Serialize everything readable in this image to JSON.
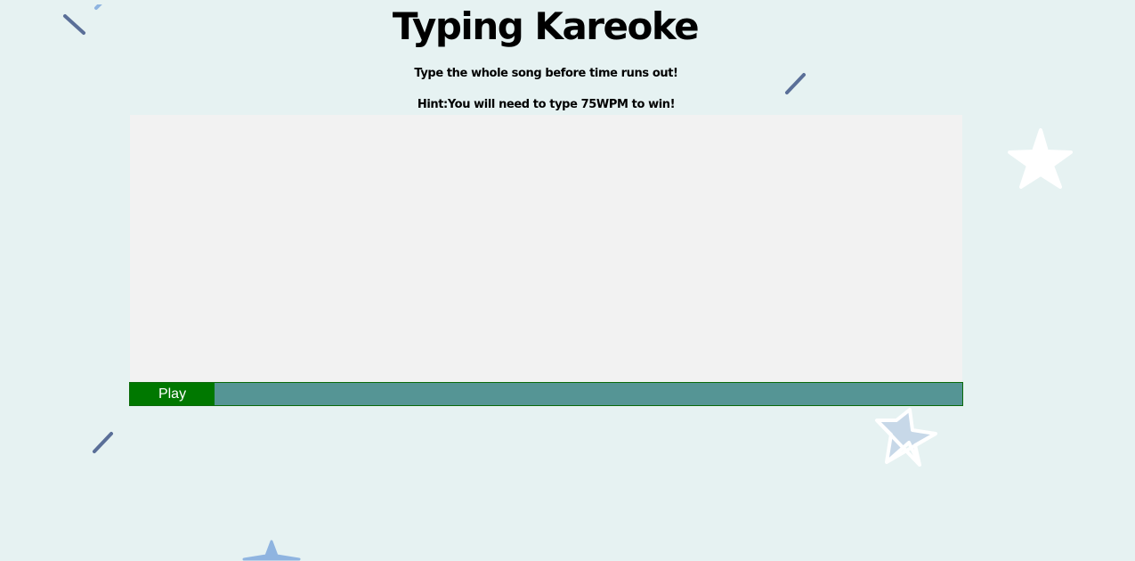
{
  "header": {
    "title": "Typing Kareoke",
    "instruction": "Type the whole song before time runs out!",
    "hint": "Hint:You will need to type 75WPM to win!"
  },
  "player": {
    "play_label": "Play",
    "progress": 0
  },
  "decorations": {
    "icons": [
      "dash-icon",
      "star-icon",
      "star-outline-icon"
    ],
    "colors": {
      "background": "#e6f2f2",
      "panel": "#f2f2f2",
      "play_button": "#007800",
      "progress_track": "#559595",
      "dash": "#5a6f98",
      "star_white": "#ffffff",
      "star_blue": "#8fb4e0"
    }
  }
}
